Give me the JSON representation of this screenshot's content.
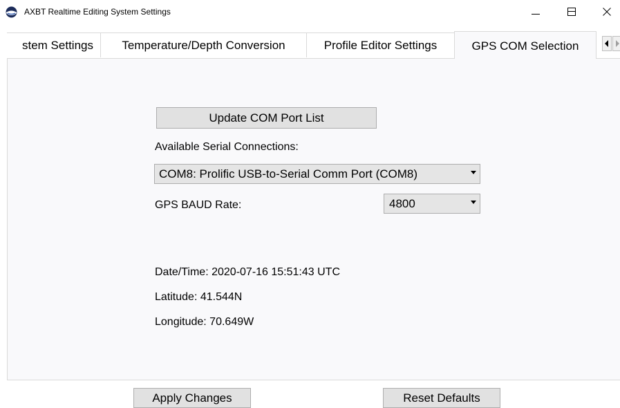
{
  "window": {
    "title": "AXBT Realtime Editing System Settings",
    "icon": "globe-icon",
    "controls": {
      "minimize": "minimize-icon",
      "maximize": "maximize-icon",
      "close": "close-icon"
    }
  },
  "tabs": [
    {
      "label": "stem Settings",
      "active": false
    },
    {
      "label": "Temperature/Depth Conversion",
      "active": false
    },
    {
      "label": "Profile Editor Settings",
      "active": false
    },
    {
      "label": "GPS COM Selection",
      "active": true
    }
  ],
  "gps": {
    "update_button": "Update COM Port List",
    "available_label": "Available Serial Connections:",
    "port_selected": "COM8: Prolific USB-to-Serial Comm Port (COM8)",
    "baud_label": "GPS BAUD Rate:",
    "baud_selected": "4800",
    "datetime": "Date/Time: 2020-07-16 15:51:43 UTC",
    "latitude": "Latitude: 41.544N",
    "longitude": "Longitude: 70.649W"
  },
  "footer": {
    "apply": "Apply Changes",
    "reset": "Reset Defaults"
  },
  "colors": {
    "panel_bg": "#f9f9fb",
    "button_bg": "#e1e1e1",
    "border": "#adadad"
  }
}
